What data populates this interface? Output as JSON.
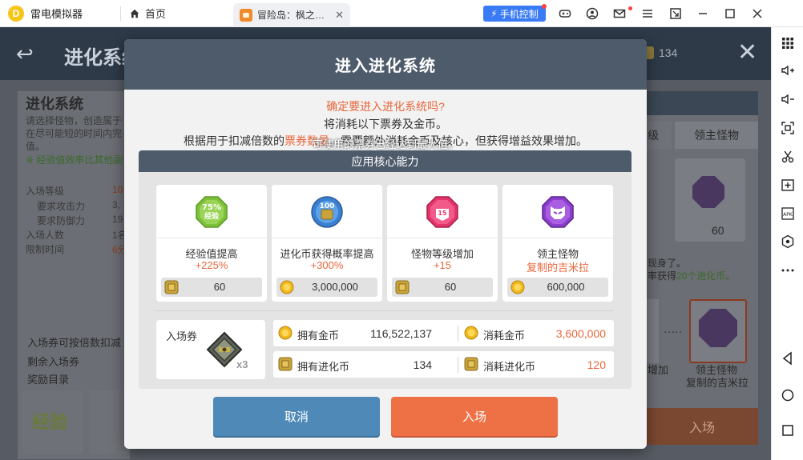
{
  "emulator": {
    "brand": "雷电模拟器",
    "home_tab": "首页",
    "game_tab": "冒险岛：枫之…",
    "phone_control": "手机控制"
  },
  "background": {
    "title": "进化系统",
    "coin_count": "134",
    "panel_title": "进化系统",
    "panel_lines": [
      "请选择怪物，创造属于",
      "在尽可能短的时间内完",
      "值。"
    ],
    "panel_green": "※ 经验值效率比其他副",
    "stats": [
      {
        "label": "入场等级",
        "value": "10"
      },
      {
        "label": "要求攻击力",
        "value": "3,"
      },
      {
        "label": "要求防御力",
        "value": "19"
      },
      {
        "label": "入场人数",
        "value": "1名"
      },
      {
        "label": "限制时间",
        "value": "6分"
      }
    ],
    "ticket_note": "入场券可按倍数扣减",
    "remaining_tickets": "剩余入场券",
    "rewards": "奖励目录",
    "reward_badge": "经验",
    "right_tab_partial": "级",
    "right_tab": "领主怪物",
    "right_card_value": "60",
    "right_text1": "现身了。",
    "right_text2_prefix": "率获得",
    "right_text2_highlight": "20个进化币。",
    "right_add": "增加",
    "boss_name1": "领主怪物",
    "boss_name2": "复制的吉米拉",
    "enter": "入场"
  },
  "modal": {
    "title": "进入进化系统",
    "confirm": "确定要进入进化系统吗?",
    "line2": "将消耗以下票券及金币。",
    "line3_prefix": "根据用于扣减倍数的",
    "line3_highlight": "票券数量",
    "line3_suffix": "，需要额外消耗金币及核心，但获得增益效果增加。",
    "overlay": "可使用的票券已经达到最大值。",
    "core_title": "应用核心能力",
    "cards": [
      {
        "title": "经验值提高",
        "sub": "+225%",
        "cost": "60",
        "icon": "exp-75-badge-icon",
        "cost_icon": "evolution-coin-icon"
      },
      {
        "title": "进化币获得概率提高",
        "sub": "+300%",
        "cost": "3,000,000",
        "icon": "evolution-coin-100-icon",
        "cost_icon": "gold-coin-icon"
      },
      {
        "title": "怪物等级增加",
        "sub": "+15",
        "cost": "60",
        "icon": "monster-level-15-icon",
        "cost_icon": "evolution-coin-icon"
      },
      {
        "title": "领主怪物",
        "sub": "复制的吉米拉",
        "cost": "600,000",
        "icon": "boss-monster-icon",
        "cost_icon": "gold-coin-icon"
      }
    ],
    "ticket": {
      "label": "入场券",
      "count": "x3"
    },
    "owned_gold_label": "拥有金币",
    "owned_gold": "116,522,137",
    "spend_gold_label": "消耗金币",
    "spend_gold": "3,600,000",
    "owned_coin_label": "拥有进化币",
    "owned_coin": "134",
    "spend_coin_label": "消耗进化币",
    "spend_coin": "120",
    "cancel": "取消",
    "enter": "入场"
  },
  "colors": {
    "accent_orange": "#e8663b",
    "header_slate": "#4e5b6b",
    "cancel_blue": "#4e89b8",
    "enter_orange": "#ee7045"
  }
}
